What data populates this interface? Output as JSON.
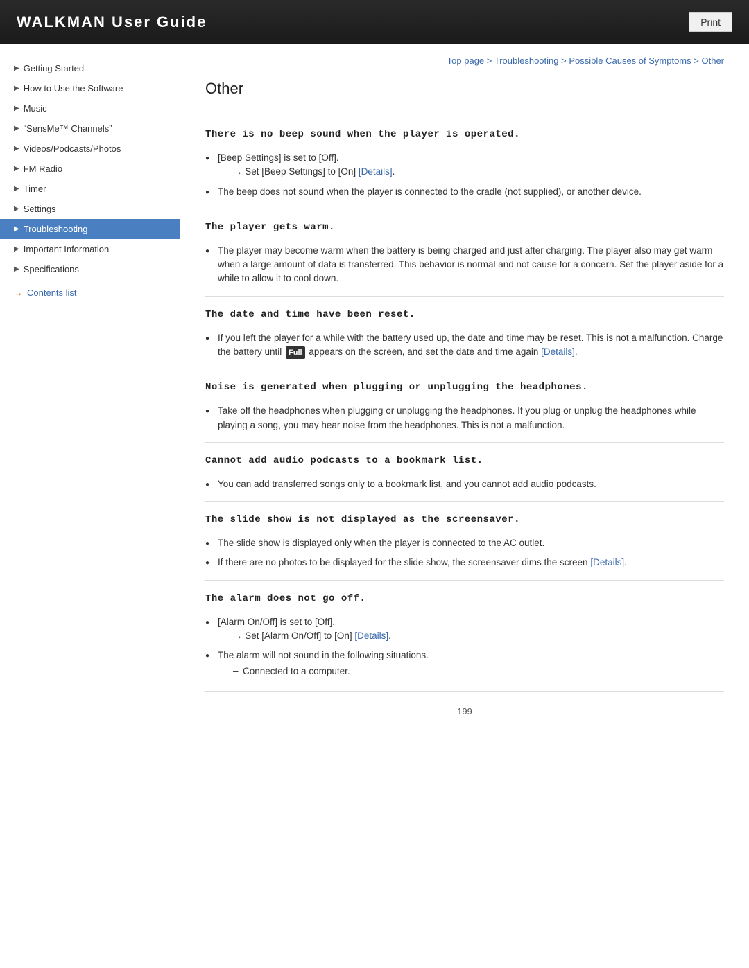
{
  "header": {
    "title": "WALKMAN User Guide",
    "print_label": "Print"
  },
  "breadcrumb": {
    "top_page": "Top page",
    "troubleshooting": "Troubleshooting",
    "possible_causes": "Possible Causes of Symptoms",
    "other": "Other"
  },
  "sidebar": {
    "items": [
      {
        "label": "Getting Started",
        "active": false
      },
      {
        "label": "How to Use the Software",
        "active": false
      },
      {
        "label": "Music",
        "active": false
      },
      {
        "label": "“SensMe™ Channels”",
        "active": false
      },
      {
        "label": "Videos/Podcasts/Photos",
        "active": false
      },
      {
        "label": "FM Radio",
        "active": false
      },
      {
        "label": "Timer",
        "active": false
      },
      {
        "label": "Settings",
        "active": false
      },
      {
        "label": "Troubleshooting",
        "active": true
      },
      {
        "label": "Important Information",
        "active": false
      },
      {
        "label": "Specifications",
        "active": false
      }
    ],
    "contents_link": "Contents list"
  },
  "page": {
    "title": "Other",
    "sections": [
      {
        "title": "There is no beep sound when the player is operated.",
        "bullets": [
          {
            "text": "[Beep Settings] is set to [Off].",
            "sub": "→ Set [Beep Settings] to [On] [Details].",
            "sub_link": "Details"
          },
          {
            "text": "The beep does not sound when the player is connected to the cradle (not supplied), or another device.",
            "sub": null
          }
        ]
      },
      {
        "title": "The player gets warm.",
        "bullets": [
          {
            "text": "The player may become warm when the battery is being charged and just after charging. The player also may get warm when a large amount of data is transferred. This behavior is normal and not cause for a concern. Set the player aside for a while to allow it to cool down.",
            "sub": null
          }
        ]
      },
      {
        "title": "The date and time have been reset.",
        "bullets": [
          {
            "text_parts": [
              "If you left the player for a while with the battery used up, the date and time may be reset. This is not a malfunction. Charge the battery until ",
              " appears on the screen, and set the date and time again ",
              "."
            ],
            "battery_icon": "Full",
            "link_label": "[Details]",
            "sub": null
          }
        ]
      },
      {
        "title": "Noise is generated when plugging or unplugging the headphones.",
        "bullets": [
          {
            "text": "Take off the headphones when plugging or unplugging the headphones. If you plug or unplug the headphones while playing a song, you may hear noise from the headphones. This is not a malfunction.",
            "sub": null
          }
        ]
      },
      {
        "title": "Cannot add audio podcasts to a bookmark list.",
        "bullets": [
          {
            "text": "You can add transferred songs only to a bookmark list, and you cannot add audio podcasts.",
            "sub": null
          }
        ]
      },
      {
        "title": "The slide show is not displayed as the screensaver.",
        "bullets": [
          {
            "text": "The slide show is displayed only when the player is connected to the AC outlet.",
            "sub": null
          },
          {
            "text_parts": [
              "If there are no photos to be displayed for the slide show, the screensaver dims the screen ",
              "."
            ],
            "link_label": "[Details]",
            "sub": null
          }
        ]
      },
      {
        "title": "The alarm does not go off.",
        "bullets": [
          {
            "text": "[Alarm On/Off] is set to [Off].",
            "sub": "→ Set [Alarm On/Off] to [On] [Details].",
            "sub_link": "Details"
          },
          {
            "text": "The alarm will not sound in the following situations.",
            "sub": null,
            "dash_items": [
              "Connected to a computer."
            ]
          }
        ]
      }
    ],
    "footer_page": "199"
  }
}
